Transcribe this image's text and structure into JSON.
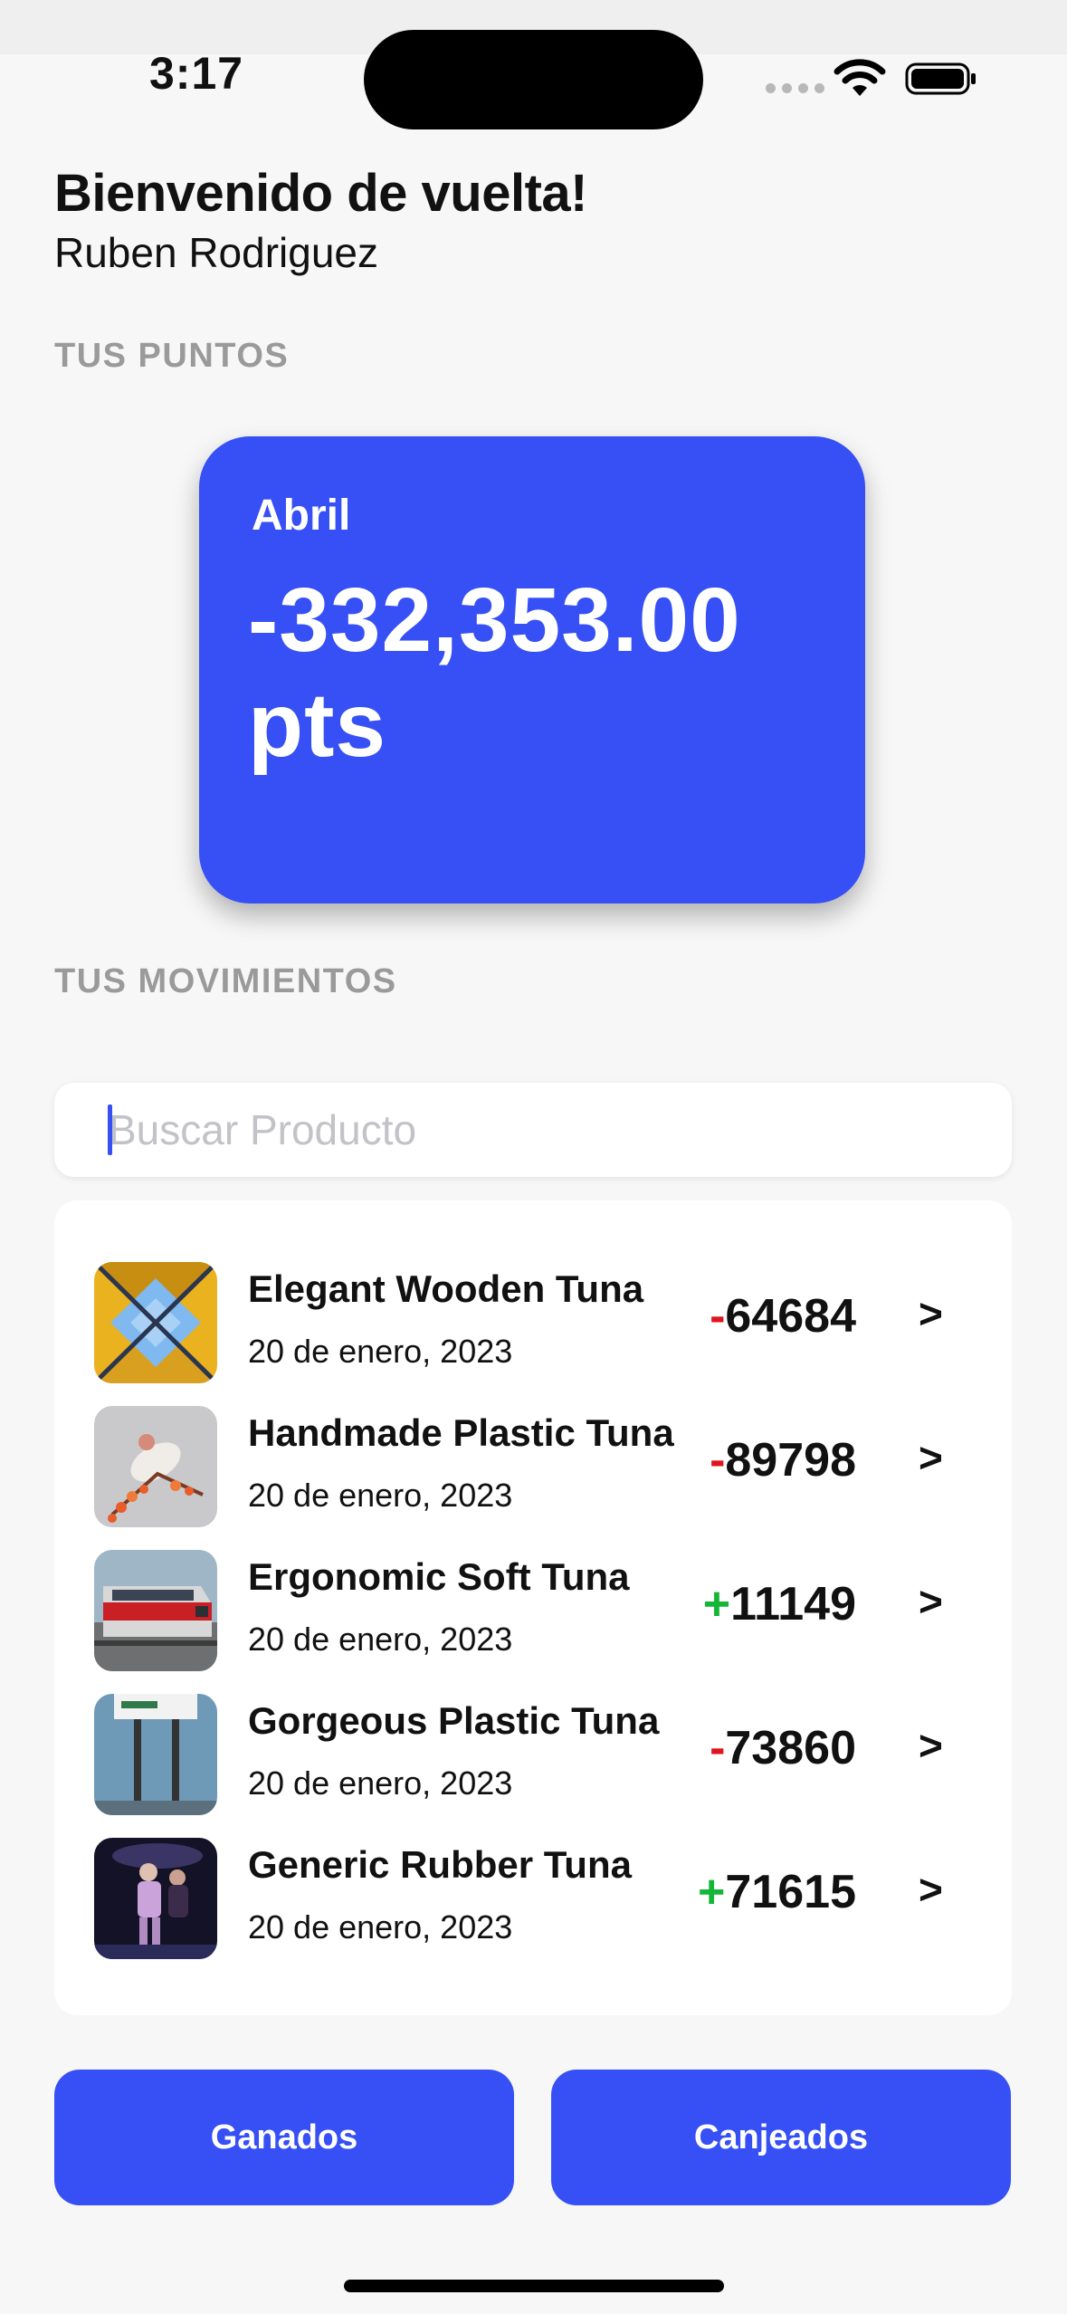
{
  "status_bar": {
    "time": "3:17"
  },
  "header": {
    "greeting": "Bienvenido de vuelta!",
    "user_name": "Ruben Rodriguez"
  },
  "points_section": {
    "label": "TUS PUNTOS",
    "card": {
      "month": "Abril",
      "amount": "-332,353.00 pts",
      "color": "#3650f5"
    }
  },
  "movements_section": {
    "label": "TUS MOVIMIENTOS"
  },
  "search": {
    "placeholder": "Buscar Producto"
  },
  "movements": [
    {
      "name": "Elegant Wooden Tuna",
      "date": "20 de enero, 2023",
      "sign": "-",
      "amount": "64684",
      "chevron": ">",
      "thumb_icon": "building-sky-thumbnail"
    },
    {
      "name": "Handmade Plastic Tuna",
      "date": "20 de enero, 2023",
      "sign": "-",
      "amount": "89798",
      "chevron": ">",
      "thumb_icon": "bird-branch-thumbnail"
    },
    {
      "name": "Ergonomic Soft Tuna",
      "date": "20 de enero, 2023",
      "sign": "+",
      "amount": "11149",
      "chevron": ">",
      "thumb_icon": "train-thumbnail"
    },
    {
      "name": "Gorgeous Plastic Tuna",
      "date": "20 de enero, 2023",
      "sign": "-",
      "amount": "73860",
      "chevron": ">",
      "thumb_icon": "sign-post-thumbnail"
    },
    {
      "name": "Generic Rubber Tuna",
      "date": "20 de enero, 2023",
      "sign": "+",
      "amount": "71615",
      "chevron": ">",
      "thumb_icon": "dancers-thumbnail"
    }
  ],
  "buttons": {
    "earned": "Ganados",
    "redeemed": "Canjeados"
  },
  "colors": {
    "accent": "#3650f5",
    "negative": "#e0141e",
    "positive": "#14b637",
    "section_label": "#9a9a9a"
  }
}
